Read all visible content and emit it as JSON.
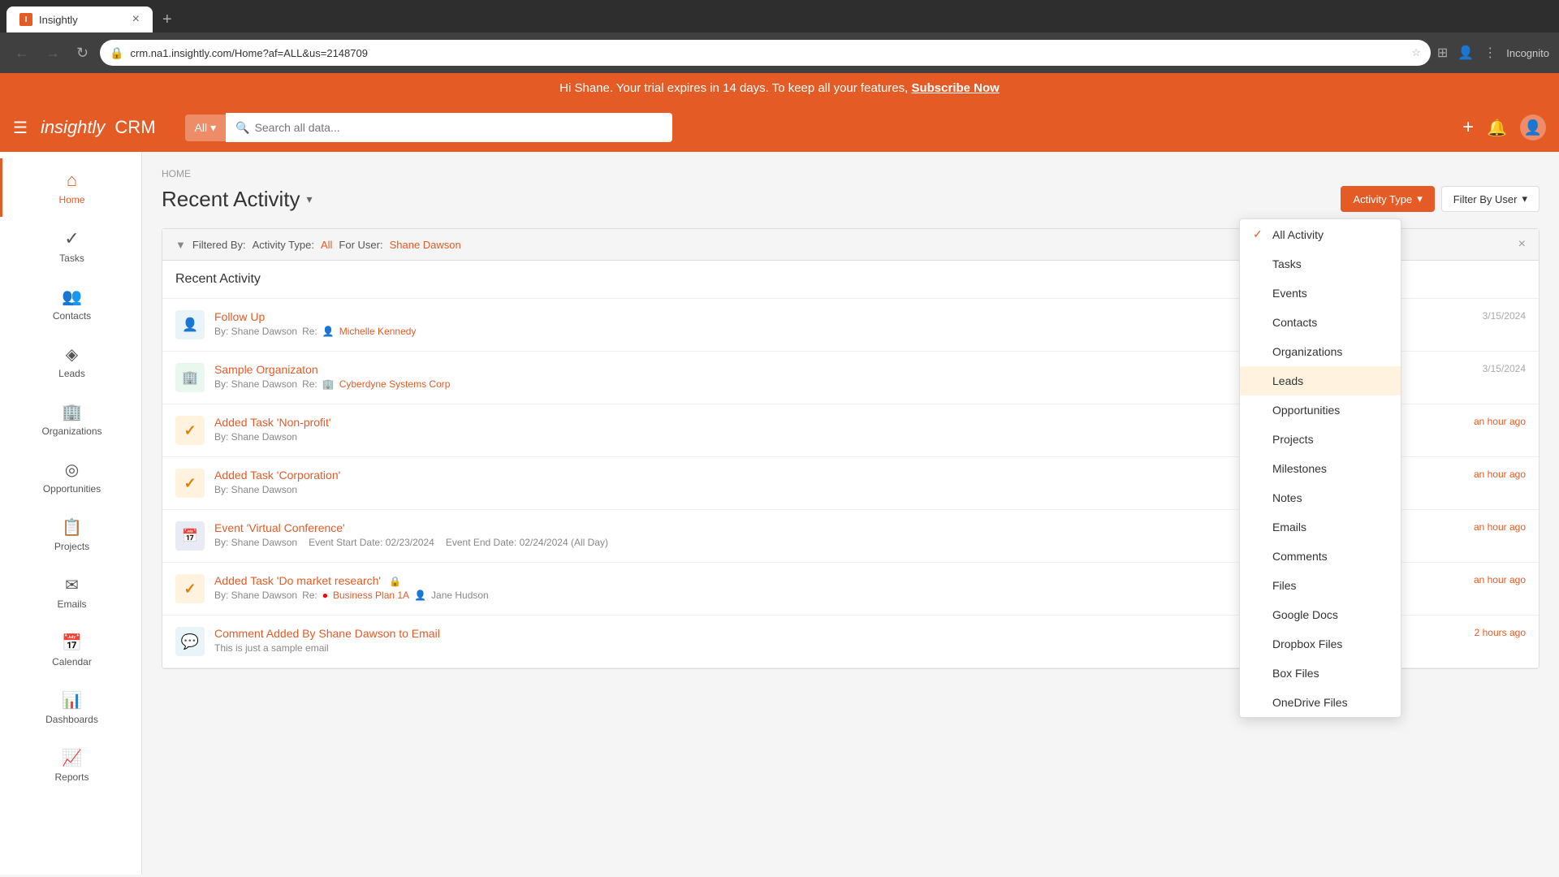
{
  "browser": {
    "tab_title": "Insightly",
    "tab_favicon": "I",
    "new_tab_icon": "+",
    "address": "crm.na1.insightly.com/Home?af=ALL&us=2148709",
    "nav_back": "←",
    "nav_forward": "→",
    "nav_refresh": "↻",
    "incognito_label": "Incognito"
  },
  "banner": {
    "text": "Hi Shane. Your trial expires in 14 days. To keep all your features,",
    "link": "Subscribe Now"
  },
  "header": {
    "logo": "insightly",
    "crm": "CRM",
    "search_all": "All",
    "search_placeholder": "Search all data...",
    "add_icon": "+",
    "bell_icon": "🔔",
    "user_icon": "👤"
  },
  "sidebar": {
    "items": [
      {
        "id": "home",
        "label": "Home",
        "icon": "⌂",
        "active": true
      },
      {
        "id": "tasks",
        "label": "Tasks",
        "icon": "✓"
      },
      {
        "id": "contacts",
        "label": "Contacts",
        "icon": "👥"
      },
      {
        "id": "leads",
        "label": "Leads",
        "icon": "◈"
      },
      {
        "id": "organizations",
        "label": "Organizations",
        "icon": "🏢"
      },
      {
        "id": "opportunities",
        "label": "Opportunities",
        "icon": "◎"
      },
      {
        "id": "projects",
        "label": "Projects",
        "icon": "📋"
      },
      {
        "id": "emails",
        "label": "Emails",
        "icon": "✉"
      },
      {
        "id": "calendar",
        "label": "Calendar",
        "icon": "📅"
      },
      {
        "id": "dashboards",
        "label": "Dashboards",
        "icon": "📊"
      },
      {
        "id": "reports",
        "label": "Reports",
        "icon": "📈"
      }
    ]
  },
  "breadcrumb": "HOME",
  "page_title": "Recent Activity",
  "filter_bar": {
    "label": "Filtered By:",
    "activity_type_label": "Activity Type:",
    "activity_type_value": "All",
    "user_label": "For User:",
    "user_value": "Shane Dawson"
  },
  "recent_activity_title": "Recent Activity",
  "activity_items": [
    {
      "id": "follow-up",
      "icon_type": "contact",
      "icon": "👤",
      "title": "Follow Up",
      "by": "By: Shane Dawson",
      "re_prefix": "Re:",
      "re_icon": "👤",
      "re_link": "Michelle Kennedy",
      "time": "",
      "date": "3/15/2024"
    },
    {
      "id": "sample-org",
      "icon_type": "org",
      "icon": "🏢",
      "title": "Sample Organizaton",
      "by": "By: Shane Dawson",
      "re_prefix": "Re:",
      "re_icon": "🏢",
      "re_link": "Cyberdyne Systems Corp",
      "time": "",
      "date": "3/15/2024"
    },
    {
      "id": "task-nonprofit",
      "icon_type": "task",
      "icon": "✓",
      "title": "Added Task 'Non-profit'",
      "by": "By: Shane Dawson",
      "re_prefix": "",
      "re_icon": "",
      "re_link": "",
      "time": "an hour ago",
      "date": ""
    },
    {
      "id": "task-corporation",
      "icon_type": "task",
      "icon": "✓",
      "title": "Added Task 'Corporation'",
      "by": "By: Shane Dawson",
      "re_prefix": "",
      "re_icon": "",
      "re_link": "",
      "time": "an hour ago",
      "date": ""
    },
    {
      "id": "event-virtual",
      "icon_type": "event",
      "icon": "📅",
      "title": "Event 'Virtual Conference'",
      "by": "By: Shane Dawson",
      "re_prefix": "Event Start Date: 02/23/2024",
      "re_icon": "",
      "re_link": "",
      "extra": "Event End Date: 02/24/2024 (All Day)",
      "time": "an hour ago",
      "date": ""
    },
    {
      "id": "task-market-research",
      "icon_type": "task",
      "icon": "✓",
      "title": "Added Task 'Do market research'",
      "by": "By: Shane Dawson",
      "re_prefix": "Re:",
      "re_icon": "🔴",
      "re_link": "Business Plan 1A",
      "extra_person": "Jane Hudson",
      "time": "an hour ago",
      "date": ""
    },
    {
      "id": "comment-email",
      "icon_type": "contact",
      "icon": "💬",
      "title": "Comment Added By Shane Dawson to Email",
      "by": "This is just a sample email",
      "re_prefix": "",
      "re_icon": "",
      "re_link": "",
      "time": "2 hours ago",
      "date": ""
    }
  ],
  "toolbar": {
    "activity_type_label": "Activity Type",
    "filter_by_user_label": "Filter By User",
    "dropdown_arrow": "▾"
  },
  "dropdown": {
    "items": [
      {
        "id": "all-activity",
        "label": "All Activity",
        "selected": true
      },
      {
        "id": "tasks",
        "label": "Tasks",
        "selected": false
      },
      {
        "id": "events",
        "label": "Events",
        "selected": false
      },
      {
        "id": "contacts",
        "label": "Contacts",
        "selected": false
      },
      {
        "id": "organizations",
        "label": "Organizations",
        "selected": false
      },
      {
        "id": "leads",
        "label": "Leads",
        "selected": false
      },
      {
        "id": "opportunities",
        "label": "Opportunities",
        "selected": false
      },
      {
        "id": "projects",
        "label": "Projects",
        "selected": false
      },
      {
        "id": "milestones",
        "label": "Milestones",
        "selected": false
      },
      {
        "id": "notes",
        "label": "Notes",
        "selected": false
      },
      {
        "id": "emails",
        "label": "Emails",
        "selected": false
      },
      {
        "id": "comments",
        "label": "Comments",
        "selected": false
      },
      {
        "id": "files",
        "label": "Files",
        "selected": false
      },
      {
        "id": "google-docs",
        "label": "Google Docs",
        "selected": false
      },
      {
        "id": "dropbox-files",
        "label": "Dropbox Files",
        "selected": false
      },
      {
        "id": "box-files",
        "label": "Box Files",
        "selected": false
      },
      {
        "id": "onedrive-files",
        "label": "OneDrive Files",
        "selected": false
      }
    ]
  }
}
